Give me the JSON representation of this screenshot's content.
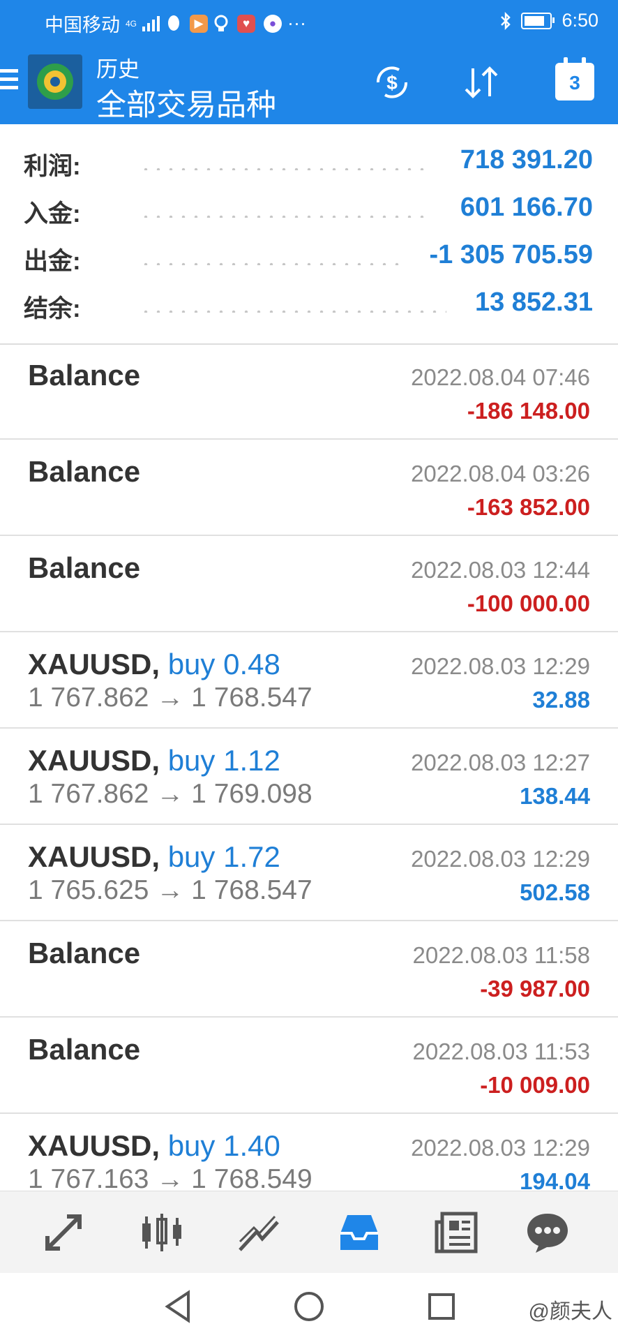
{
  "status_bar": {
    "carrier": "中国移动",
    "network": "4G",
    "time": "6:50",
    "icons": [
      "signal-icon",
      "qq-icon",
      "video-app-icon",
      "bulb-icon",
      "heart-app-icon",
      "chat-app-icon",
      "more-icon",
      "bluetooth-icon",
      "battery-icon"
    ],
    "more": "···"
  },
  "app_bar": {
    "title": "历史",
    "subtitle": "全部交易品种",
    "calendar_day": "3",
    "accent": "#1f86e8"
  },
  "summary": [
    {
      "label": "利润:",
      "value": "718 391.20"
    },
    {
      "label": "入金:",
      "value": "601 166.70"
    },
    {
      "label": "出金:",
      "value": "-1 305 705.59"
    },
    {
      "label": "结余:",
      "value": "13 852.31"
    }
  ],
  "deals": [
    {
      "symbol": "Balance",
      "time": "2022.08.04 07:46",
      "profit": "-186 148.00",
      "sign": "neg"
    },
    {
      "symbol": "Balance",
      "time": "2022.08.04 03:26",
      "profit": "-163 852.00",
      "sign": "neg"
    },
    {
      "symbol": "Balance",
      "time": "2022.08.03 12:44",
      "profit": "-100 000.00",
      "sign": "neg"
    },
    {
      "symbol": "XAUUSD,",
      "side": "buy 0.48",
      "prices": "1 767.862 → 1 768.547",
      "time": "2022.08.03 12:29",
      "profit": "32.88",
      "sign": "pos"
    },
    {
      "symbol": "XAUUSD,",
      "side": "buy 1.12",
      "prices": "1 767.862 → 1 769.098",
      "time": "2022.08.03 12:27",
      "profit": "138.44",
      "sign": "pos"
    },
    {
      "symbol": "XAUUSD,",
      "side": "buy 1.72",
      "prices": "1 765.625 → 1 768.547",
      "time": "2022.08.03 12:29",
      "profit": "502.58",
      "sign": "pos"
    },
    {
      "symbol": "Balance",
      "time": "2022.08.03 11:58",
      "profit": "-39 987.00",
      "sign": "neg"
    },
    {
      "symbol": "Balance",
      "time": "2022.08.03 11:53",
      "profit": "-10 009.00",
      "sign": "neg"
    },
    {
      "symbol": "XAUUSD,",
      "side": "buy 1.40",
      "prices": "1 767.163 → 1 768.549",
      "time": "2022.08.03 12:29",
      "profit": "194.04",
      "sign": "pos"
    }
  ],
  "bottom_nav": [
    "quotes-icon",
    "chart-icon",
    "trade-icon",
    "history-icon",
    "news-icon",
    "messages-icon"
  ],
  "bottom_nav_active": "history-icon",
  "watermark": "@颜夫人",
  "colors": {
    "positive": "#1f7fd6",
    "negative": "#cc1f1f",
    "active_nav": "#1f86e8"
  }
}
